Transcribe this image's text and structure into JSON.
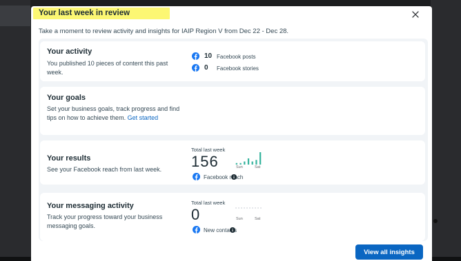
{
  "modal": {
    "title": "Your last week in review",
    "subtitle": "Take a moment to review activity and insights for IAIP Region V from Dec 22 - Dec 28."
  },
  "activity": {
    "title": "Your activity",
    "description": "You published 10 pieces of content this past week.",
    "posts_count": "10",
    "posts_label": "Facebook posts",
    "stories_count": "0",
    "stories_label": "Facebook stories"
  },
  "goals": {
    "title": "Your goals",
    "description": "Set your business goals, track progress and find tips on how to achieve them.",
    "link": "Get started"
  },
  "results": {
    "title": "Your results",
    "description": "See your Facebook reach from last week.",
    "total_label": "Total last week",
    "total_value": "156",
    "spark_start": "Sun",
    "spark_end": "Sat",
    "metric_label": "Facebook reach",
    "spark_values": [
      1,
      1,
      2,
      4,
      2,
      3,
      8
    ]
  },
  "messaging": {
    "title": "Your messaging activity",
    "description": "Track your progress toward your business messaging goals.",
    "total_label": "Total last week",
    "total_value": "0",
    "spark_start": "Sun",
    "spark_end": "Sat",
    "metric_label": "New contacts"
  },
  "footer": {
    "cta_label": "View all insights"
  },
  "colors": {
    "facebook_blue": "#1877f2",
    "primary_button": "#0a66c2",
    "sparkline_teal": "#3bb5a0",
    "highlight": "#fbf65a"
  },
  "icons": [
    "close-icon",
    "facebook-icon",
    "info-icon"
  ]
}
